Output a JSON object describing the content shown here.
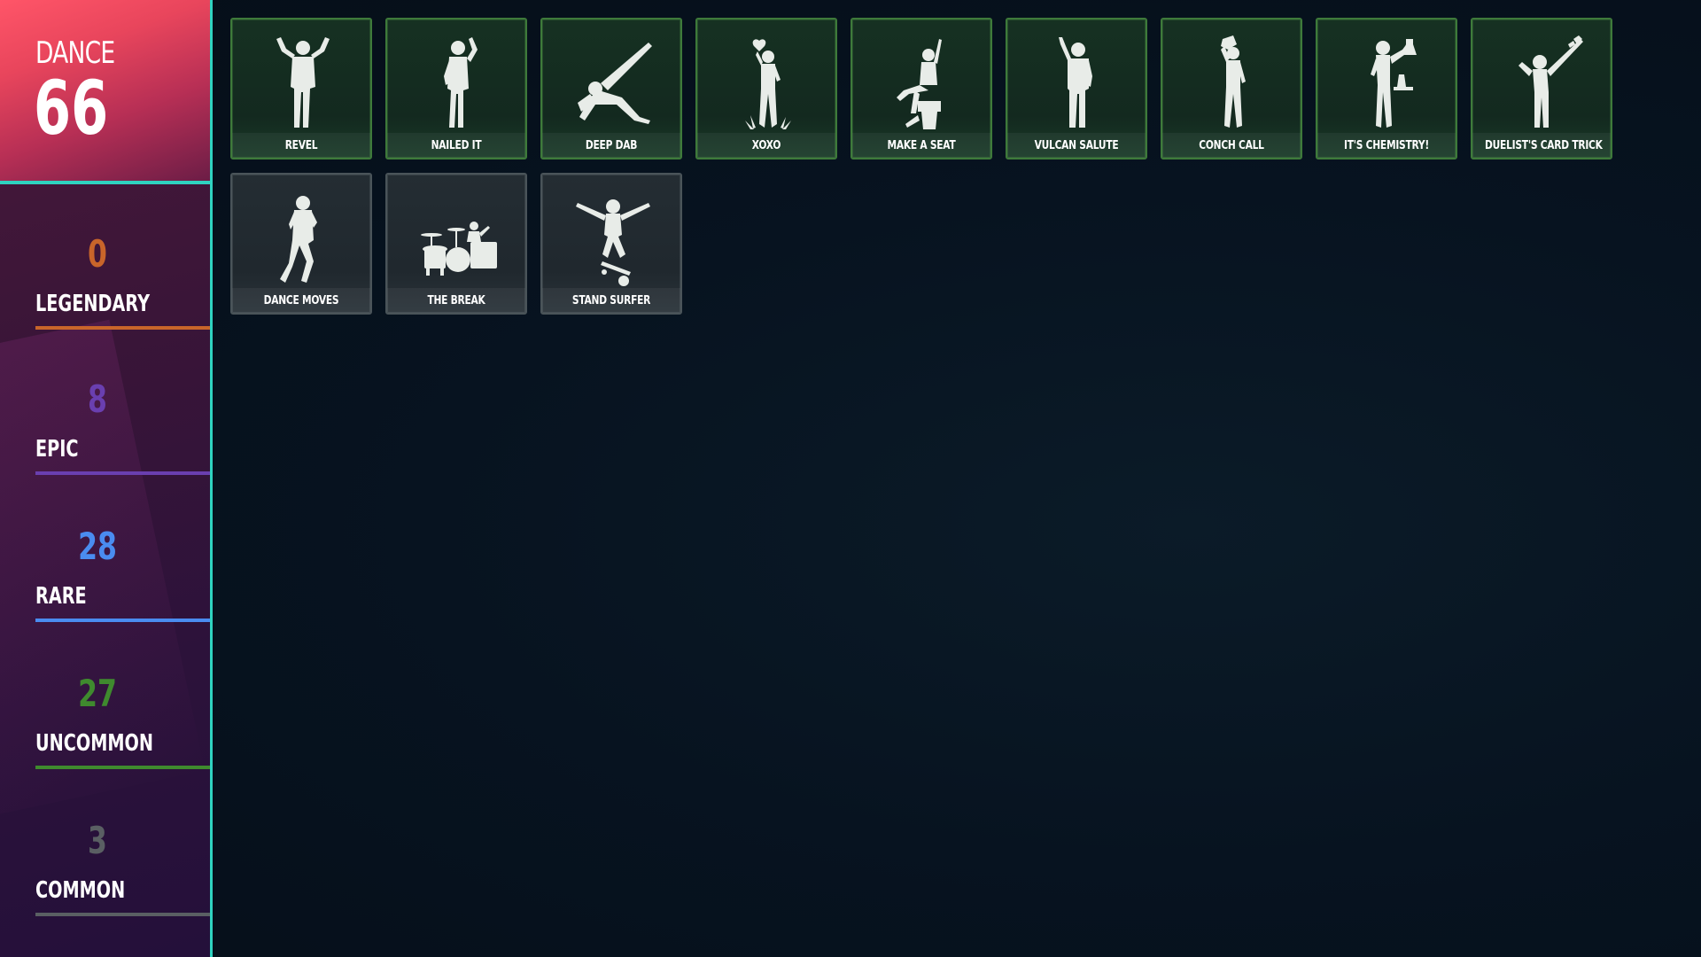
{
  "header": {
    "category": "DANCE",
    "total": "66"
  },
  "rarities": [
    {
      "key": "legendary",
      "label": "LEGENDARY",
      "count": "0",
      "color": "#c8652a"
    },
    {
      "key": "epic",
      "label": "EPIC",
      "count": "8",
      "color": "#6a3fb0"
    },
    {
      "key": "rare",
      "label": "RARE",
      "count": "28",
      "color": "#4a8cf0"
    },
    {
      "key": "uncommon",
      "label": "UNCOMMON",
      "count": "27",
      "color": "#3f8a2e"
    },
    {
      "key": "common",
      "label": "COMMON",
      "count": "3",
      "color": "#5a5f63"
    }
  ],
  "colors": {
    "accent_divider": "#2fd3c0",
    "uncommon_border": "#3e7a3a",
    "common_border": "#4a5459"
  },
  "items": [
    {
      "name": "REVEL",
      "rarity": "uncommon",
      "icon": "dancer-arms-up-icon"
    },
    {
      "name": "NAILED IT",
      "rarity": "uncommon",
      "icon": "figure-hammer-icon"
    },
    {
      "name": "DEEP DAB",
      "rarity": "uncommon",
      "icon": "figure-dab-icon"
    },
    {
      "name": "XOXO",
      "rarity": "uncommon",
      "icon": "figure-heart-icon"
    },
    {
      "name": "MAKE A SEAT",
      "rarity": "uncommon",
      "icon": "figure-seated-icon"
    },
    {
      "name": "VULCAN SALUTE",
      "rarity": "uncommon",
      "icon": "figure-salute-icon"
    },
    {
      "name": "CONCH CALL",
      "rarity": "uncommon",
      "icon": "figure-conch-icon"
    },
    {
      "name": "IT'S CHEMISTRY!",
      "rarity": "uncommon",
      "icon": "figure-chemistry-icon"
    },
    {
      "name": "DUELIST'S CARD TRICK",
      "rarity": "uncommon",
      "icon": "figure-cards-icon"
    },
    {
      "name": "DANCE MOVES",
      "rarity": "common",
      "icon": "figure-dance-icon"
    },
    {
      "name": "THE BREAK",
      "rarity": "common",
      "icon": "drum-kit-icon"
    },
    {
      "name": "STAND SURFER",
      "rarity": "common",
      "icon": "figure-skateboard-icon"
    }
  ]
}
